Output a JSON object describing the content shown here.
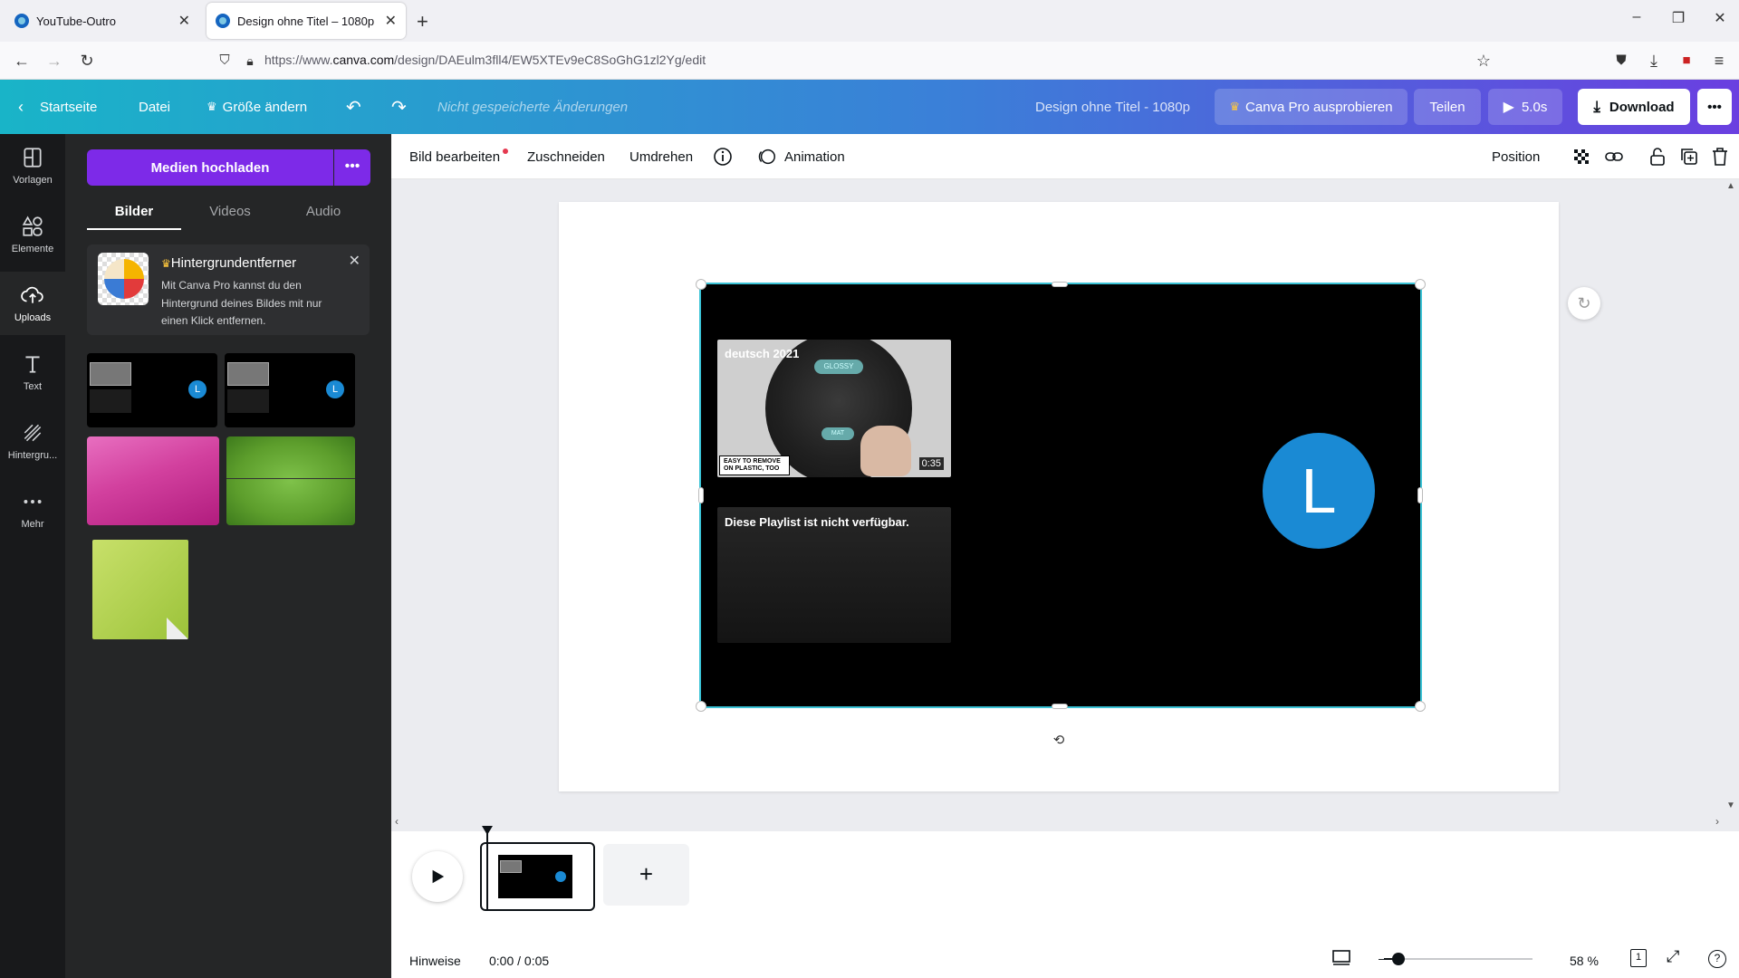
{
  "browser": {
    "tabs": [
      {
        "title": "YouTube-Outro",
        "active": false
      },
      {
        "title": "Design ohne Titel – 1080p",
        "active": true
      }
    ],
    "url_prefix": "https://www.",
    "url_domain": "canva.com",
    "url_path": "/design/DAEulm3fll4/EW5XTEv9eC8SoGhG1zl2Yg/edit"
  },
  "topbar": {
    "home": "Startseite",
    "file": "Datei",
    "resize": "Größe ändern",
    "save_status": "Nicht gespeicherte Änderungen",
    "design_title": "Design ohne Titel - 1080p",
    "pro": "Canva Pro ausprobieren",
    "share": "Teilen",
    "duration": "5.0s",
    "download": "Download"
  },
  "rail": [
    {
      "label": "Vorlagen",
      "icon": "templates-icon"
    },
    {
      "label": "Elemente",
      "icon": "elements-icon"
    },
    {
      "label": "Uploads",
      "icon": "upload-cloud-icon",
      "active": true
    },
    {
      "label": "Text",
      "icon": "text-icon"
    },
    {
      "label": "Hintergru...",
      "icon": "background-icon"
    },
    {
      "label": "Mehr",
      "icon": "more-icon"
    }
  ],
  "panel": {
    "upload_button": "Medien hochladen",
    "tabs": [
      "Bilder",
      "Videos",
      "Audio"
    ],
    "promo_title": "Hintergrundentferner",
    "promo_text": "Mit Canva Pro kannst du den Hintergrund deines Bildes mit nur einen Klick entfernen.",
    "avatar_letter": "L"
  },
  "toolbar": {
    "edit_image": "Bild bearbeiten",
    "crop": "Zuschneiden",
    "flip": "Umdrehen",
    "animation": "Animation",
    "position": "Position"
  },
  "canvas": {
    "video_title": "deutsch 2021",
    "video_duration": "0:35",
    "video_caption": "EASY TO REMOVE ON PLASTIC, TOO",
    "video_label_top": "GLOSSY",
    "video_label_bottom": "MAT",
    "playlist_text": "Diese Playlist ist nicht verfügbar.",
    "avatar_letter": "L"
  },
  "footer": {
    "notes": "Hinweise",
    "time": "0:00 / 0:05",
    "zoom": "58 %",
    "zoom_fraction": 0.1,
    "page_number": "1"
  },
  "colors": {
    "accent": "#7d2ae8",
    "selection": "#3bc3d6",
    "avatar": "#1a8ad4"
  }
}
